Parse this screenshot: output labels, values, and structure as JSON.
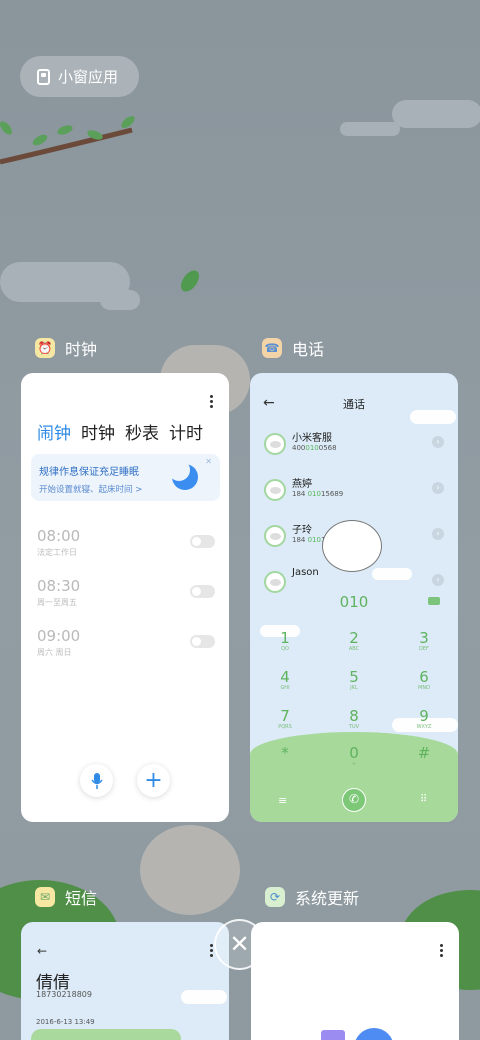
{
  "floating_window_button": {
    "label": "小窗应用"
  },
  "apps": {
    "clock": {
      "name": "时钟"
    },
    "phone": {
      "name": "电话"
    },
    "sms": {
      "name": "短信"
    },
    "update": {
      "name": "系统更新"
    }
  },
  "clock_card": {
    "tabs": [
      "闹钟",
      "时钟",
      "秒表",
      "计时"
    ],
    "banner": {
      "title": "规律作息保证充足睡眠",
      "subtitle": "开始设置就寝、起床时间 >"
    },
    "alarms": [
      {
        "time": "08:00",
        "days": "法定工作日",
        "enabled": false
      },
      {
        "time": "08:30",
        "days": "周一至周五",
        "enabled": false
      },
      {
        "time": "09:00",
        "days": "周六 周日",
        "enabled": false
      }
    ]
  },
  "phone_card": {
    "title": "通话",
    "contacts": [
      {
        "name": "小米客服",
        "number_prefix": "400",
        "number_highlight": "010",
        "number_suffix": "0568"
      },
      {
        "name": "燕婷",
        "number_prefix": "184 ",
        "number_highlight": "010",
        "number_suffix": "15689"
      },
      {
        "name": "子玲",
        "number_prefix": "184 ",
        "number_highlight": "010",
        "number_suffix": "15678"
      },
      {
        "name": "Jason",
        "number_prefix": "",
        "number_highlight": "",
        "number_suffix": ""
      }
    ],
    "dialed": "010",
    "keys": [
      {
        "digit": "1",
        "letters": "QO"
      },
      {
        "digit": "2",
        "letters": "ABC"
      },
      {
        "digit": "3",
        "letters": "DEF"
      },
      {
        "digit": "4",
        "letters": "GHI"
      },
      {
        "digit": "5",
        "letters": "JKL"
      },
      {
        "digit": "6",
        "letters": "MNO"
      },
      {
        "digit": "7",
        "letters": "PQRS"
      },
      {
        "digit": "8",
        "letters": "TUV"
      },
      {
        "digit": "9",
        "letters": "WXYZ"
      },
      {
        "digit": "*",
        "letters": ""
      },
      {
        "digit": "0",
        "letters": "+"
      },
      {
        "digit": "#",
        "letters": ""
      }
    ]
  },
  "sms_card": {
    "contact_name": "倩倩",
    "phone": "18730218809",
    "date": "2016-6-13 13:49"
  },
  "colors": {
    "accent_blue": "#2f8be6",
    "dial_green": "#5fb35f"
  }
}
